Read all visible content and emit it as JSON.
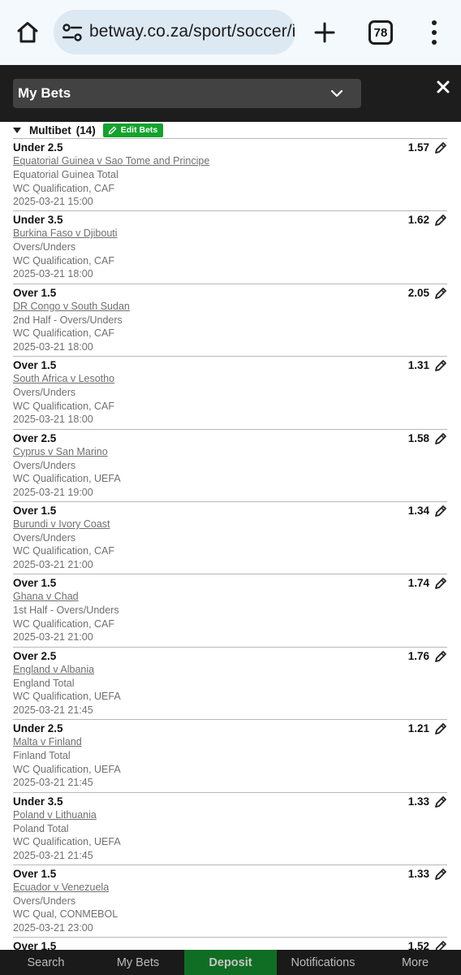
{
  "browser": {
    "url": "betway.co.za/sport/soccer/int/",
    "tab_count": "78"
  },
  "header": {
    "dropdown_label": "My Bets"
  },
  "multibet": {
    "label": "Multibet",
    "count": "(14)",
    "edit_label": "Edit Bets"
  },
  "bets": [
    {
      "selection": "Under 2.5",
      "odds": "1.57",
      "match": "Equatorial Guinea v Sao Tome and Principe",
      "market": "Equatorial Guinea Total",
      "competition": "WC Qualification, CAF",
      "time": "2025-03-21 15:00"
    },
    {
      "selection": "Under 3.5",
      "odds": "1.62",
      "match": "Burkina Faso v Djibouti",
      "market": "Overs/Unders",
      "competition": "WC Qualification, CAF",
      "time": "2025-03-21 18:00"
    },
    {
      "selection": "Over 1.5",
      "odds": "2.05",
      "match": "DR Congo v South Sudan",
      "market": "2nd Half - Overs/Unders",
      "competition": "WC Qualification, CAF",
      "time": "2025-03-21 18:00"
    },
    {
      "selection": "Over 1.5",
      "odds": "1.31",
      "match": "South Africa v Lesotho",
      "market": "Overs/Unders",
      "competition": "WC Qualification, CAF",
      "time": "2025-03-21 18:00"
    },
    {
      "selection": "Over 2.5",
      "odds": "1.58",
      "match": "Cyprus v San Marino",
      "market": "Overs/Unders",
      "competition": "WC Qualification, UEFA",
      "time": "2025-03-21 19:00"
    },
    {
      "selection": "Over 1.5",
      "odds": "1.34",
      "match": "Burundi v Ivory Coast",
      "market": "Overs/Unders",
      "competition": "WC Qualification, CAF",
      "time": "2025-03-21 21:00"
    },
    {
      "selection": "Over 1.5",
      "odds": "1.74",
      "match": "Ghana v Chad",
      "market": "1st Half - Overs/Unders",
      "competition": "WC Qualification, CAF",
      "time": "2025-03-21 21:00"
    },
    {
      "selection": "Over 2.5",
      "odds": "1.76",
      "match": "England v Albania",
      "market": "England Total",
      "competition": "WC Qualification, UEFA",
      "time": "2025-03-21 21:45"
    },
    {
      "selection": "Under 2.5",
      "odds": "1.21",
      "match": "Malta v Finland",
      "market": "Finland Total",
      "competition": "WC Qualification, UEFA",
      "time": "2025-03-21 21:45"
    },
    {
      "selection": "Under 3.5",
      "odds": "1.33",
      "match": "Poland v Lithuania",
      "market": "Poland Total",
      "competition": "WC Qualification, UEFA",
      "time": "2025-03-21 21:45"
    },
    {
      "selection": "Over 1.5",
      "odds": "1.33",
      "match": "Ecuador v Venezuela",
      "market": "Overs/Unders",
      "competition": "WC Qual, CONMEBOL",
      "time": "2025-03-21 23:00"
    },
    {
      "selection": "Over 1.5",
      "odds": "1.52",
      "match": "",
      "market": "",
      "competition": "",
      "time": ""
    }
  ],
  "bottom_nav": {
    "search": "Search",
    "my_bets": "My Bets",
    "deposit": "Deposit",
    "notifications": "Notifications",
    "more": "More"
  },
  "colors": {
    "deposit_green": "#0f6e23",
    "edit_green": "#11a32b",
    "header_dark": "#1d1d1d"
  },
  "icons": {
    "home": "home-icon",
    "site_settings": "site-settings-icon",
    "new_tab": "plus-icon",
    "tabs": "tab-switcher-icon",
    "menu": "more-vert-icon",
    "dropdown": "chevron-down-icon",
    "close": "close-icon",
    "edit": "pencil-icon"
  }
}
